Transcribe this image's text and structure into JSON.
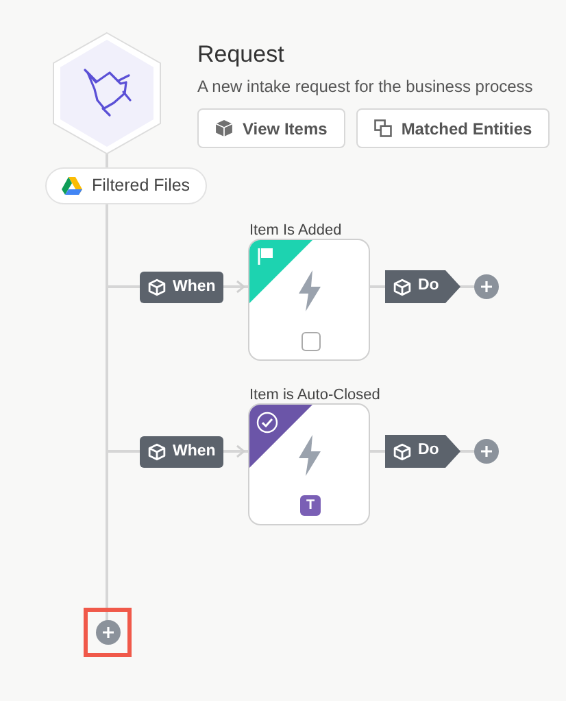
{
  "process": {
    "title": "Request",
    "description": "A new intake request for the business process"
  },
  "buttons": [
    {
      "label": "View Items",
      "kind": "cube"
    },
    {
      "label": "Matched Entities",
      "kind": "squares"
    }
  ],
  "source": {
    "label": "Filtered Files"
  },
  "triggers": [
    {
      "label": "Item Is Added",
      "when": "When",
      "action": "Do",
      "color": "#1dd3b0",
      "kind": "flag",
      "badge": {
        "kind": "checkbox",
        "checked": false
      }
    },
    {
      "label": "Item is Auto-Closed",
      "when": "When",
      "action": "Do",
      "color": "#6b55a8",
      "kind": "check",
      "badge": {
        "kind": "letter",
        "text": "T"
      }
    }
  ],
  "add_step": {
    "selected": true
  }
}
